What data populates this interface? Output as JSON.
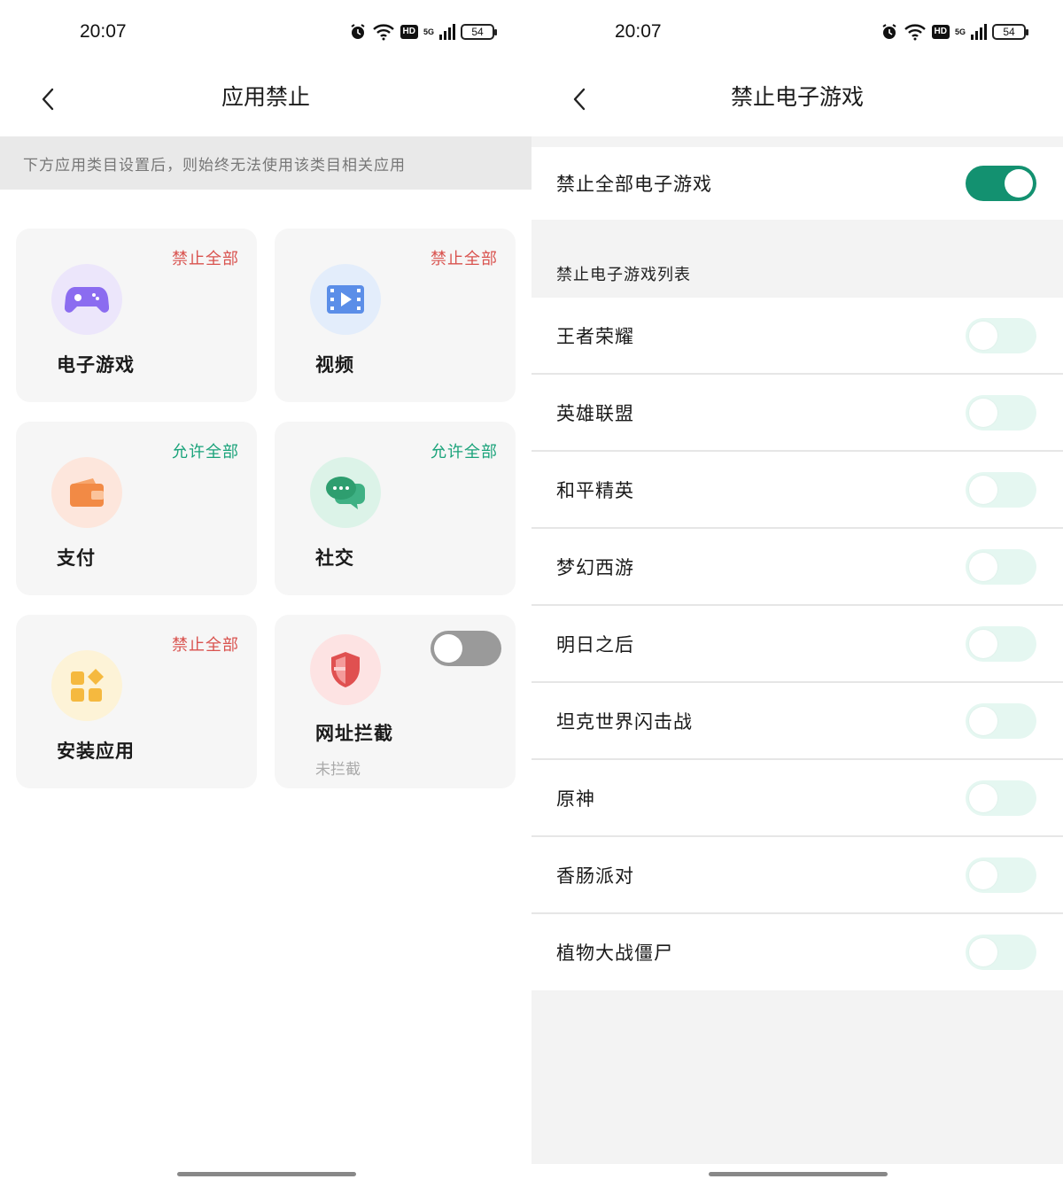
{
  "status_bar": {
    "time": "20:07",
    "hd": "HD",
    "signal": "5G",
    "battery": "54"
  },
  "left": {
    "title": "应用禁止",
    "banner": "下方应用类目设置后，则始终无法使用该类目相关应用",
    "cards": [
      {
        "label": "电子游戏",
        "status": "禁止全部",
        "icon": "gamepad-icon"
      },
      {
        "label": "视频",
        "status": "禁止全部",
        "icon": "video-icon"
      },
      {
        "label": "支付",
        "status": "允许全部",
        "icon": "wallet-icon"
      },
      {
        "label": "社交",
        "status": "允许全部",
        "icon": "chat-icon"
      },
      {
        "label": "安装应用",
        "status": "禁止全部",
        "icon": "apps-icon"
      },
      {
        "label": "网址拦截",
        "sub": "未拦截",
        "icon": "shield-icon",
        "toggle_on": false
      }
    ]
  },
  "right": {
    "title": "禁止电子游戏",
    "master_label": "禁止全部电子游戏",
    "master_on": true,
    "section_title": "禁止电子游戏列表",
    "games": [
      "王者荣耀",
      "英雄联盟",
      "和平精英",
      "梦幻西游",
      "明日之后",
      "坦克世界闪击战",
      "原神",
      "香肠派对",
      "植物大战僵尸"
    ]
  },
  "colors": {
    "ban": "#d9534f",
    "allow": "#1aa37a",
    "toggle_on": "#139170",
    "toggle_light": "#e5f7f1"
  }
}
